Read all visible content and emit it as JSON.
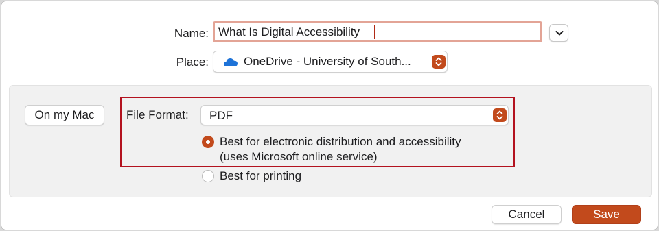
{
  "name": {
    "label": "Name:",
    "value": "What Is Digital Accessibility"
  },
  "place": {
    "label": "Place:",
    "value": "OneDrive - University of South..."
  },
  "location_button": {
    "label": "On my Mac"
  },
  "file_format": {
    "label": "File Format:",
    "value": "PDF",
    "options": [
      {
        "line1": "Best for electronic distribution and accessibility",
        "line2": "(uses Microsoft online service)",
        "selected": true
      },
      {
        "line1": "Best for printing",
        "selected": false
      }
    ]
  },
  "buttons": {
    "cancel": "Cancel",
    "save": "Save"
  },
  "colors": {
    "accent": "#c24a1c",
    "highlight_border": "#b3121f",
    "name_field_border": "#e3a496",
    "onedrive_blue": "#1e73d8"
  },
  "icons": {
    "expand": "chevron-down-icon",
    "place": "onedrive-cloud-icon",
    "stepper": "up-down-chevrons-icon"
  }
}
